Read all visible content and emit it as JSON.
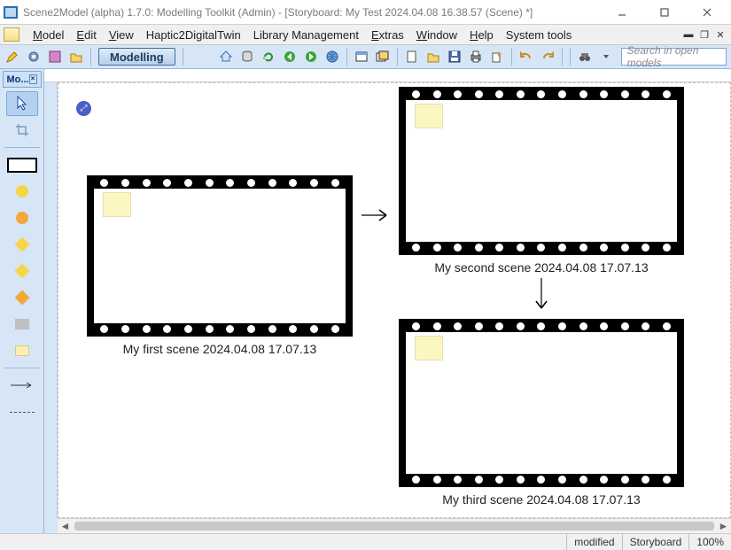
{
  "title": "Scene2Model (alpha) 1.7.0: Modelling Toolkit (Admin) - [Storyboard: My Test 2024.04.08 16.38.57 (Scene) *]",
  "menu": {
    "model": "Model",
    "edit": "Edit",
    "view": "View",
    "haptic": "Haptic2DigitalTwin",
    "library": "Library Management",
    "extras": "Extras",
    "window": "Window",
    "help": "Help",
    "system": "System tools"
  },
  "toolbar": {
    "icons": {
      "tool1": "pencil-icon",
      "tool2": "gear-icon",
      "tool3": "puzzle-icon",
      "tool4": "folder-icon",
      "home": "home-icon",
      "db": "database-icon",
      "refresh": "refresh-icon",
      "back": "back-icon",
      "fwd": "forward-icon",
      "world": "world-icon",
      "m1": "card-icon",
      "m2": "cards-icon",
      "new": "new-icon",
      "open": "open-icon",
      "save": "save-icon",
      "print": "print-icon",
      "export": "export-icon",
      "undo": "undo-icon",
      "redo": "redo-icon",
      "find": "find-icon"
    },
    "mode": "Modelling",
    "search_placeholder": "Search in open models"
  },
  "palette": {
    "tab": "Mo...",
    "colors": {
      "yellow": "#f7d548",
      "orange": "#f2a93b",
      "gray": "#c0c0c0",
      "cream": "#fbeeb3"
    }
  },
  "scenes": [
    {
      "label": "My first scene 2024.04.08 17.07.13"
    },
    {
      "label": "My second scene 2024.04.08 17.07.13"
    },
    {
      "label": "My third scene 2024.04.08 17.07.13"
    }
  ],
  "status": {
    "modified": "modified",
    "type": "Storyboard",
    "zoom": "100%"
  }
}
